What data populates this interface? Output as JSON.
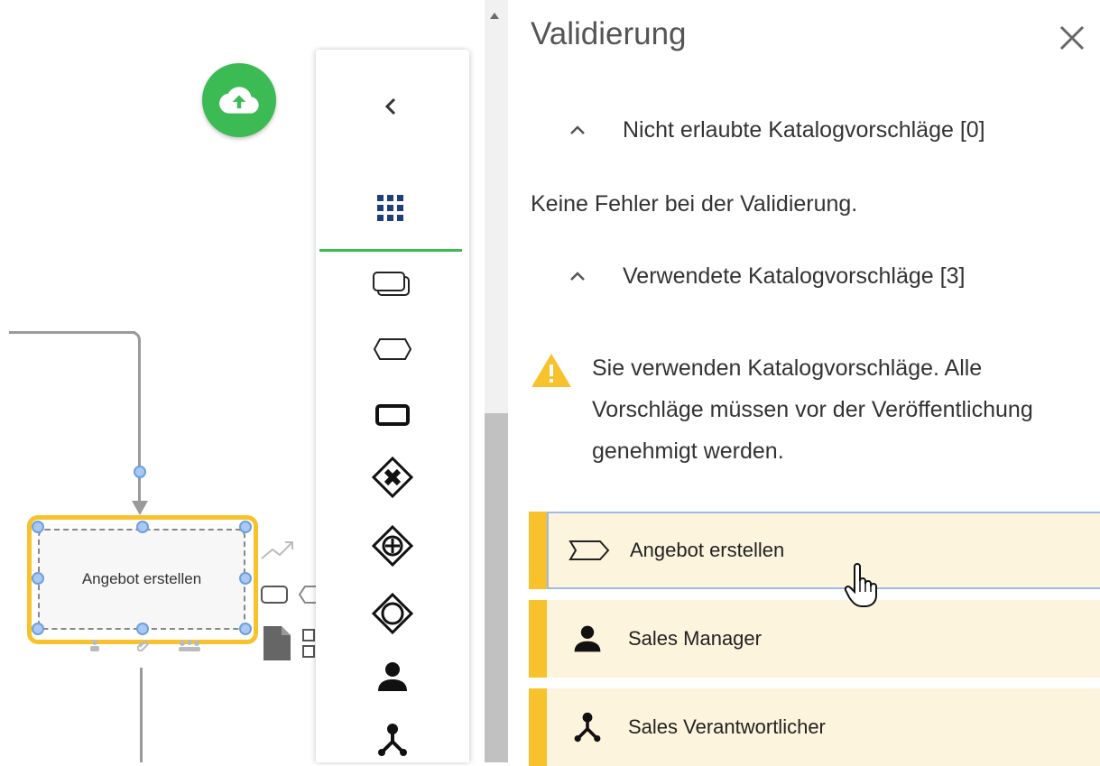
{
  "canvas": {
    "task": {
      "label": "Angebot erstellen"
    },
    "upload_button": {
      "icon": "cloud-upload-icon",
      "color": "#3cba54"
    },
    "selection_color": "#f7c22b",
    "context_pad": [
      "connect-icon",
      "task-icon",
      "subprocess-icon",
      "data-object-icon",
      "grid-icon",
      "person-icon",
      "attachment-icon",
      "group-icon"
    ]
  },
  "palette": {
    "collapse_icon": "chevron-left-icon",
    "grid_icon": "apps-grid-icon",
    "accent_color": "#3cba54",
    "items": [
      {
        "name": "subprocess-icon"
      },
      {
        "name": "event-subprocess-icon"
      },
      {
        "name": "task-icon"
      },
      {
        "name": "exclusive-gateway-icon"
      },
      {
        "name": "parallel-gateway-icon"
      },
      {
        "name": "event-gateway-icon"
      },
      {
        "name": "person-icon"
      },
      {
        "name": "role-icon"
      }
    ]
  },
  "panel": {
    "title": "Validierung",
    "close_icon": "close-icon",
    "sections": [
      {
        "label": "Nicht erlaubte Katalogvorschläge [0]"
      },
      {
        "label": "Verwendete Katalogvorschläge [3]"
      }
    ],
    "no_errors_text": "Keine Fehler bei der Validierung.",
    "warning": {
      "icon": "warning-icon",
      "color": "#f7c22b",
      "text": "Sie verwenden Katalogvorschläge. Alle Vorschläge müssen vor der Veröffentlichung genehmigt werden."
    },
    "items": [
      {
        "label": "Angebot erstellen",
        "icon": "process-step-icon"
      },
      {
        "label": "Sales Manager",
        "icon": "person-icon"
      },
      {
        "label": "Sales Verantwortlicher",
        "icon": "role-icon"
      }
    ]
  }
}
